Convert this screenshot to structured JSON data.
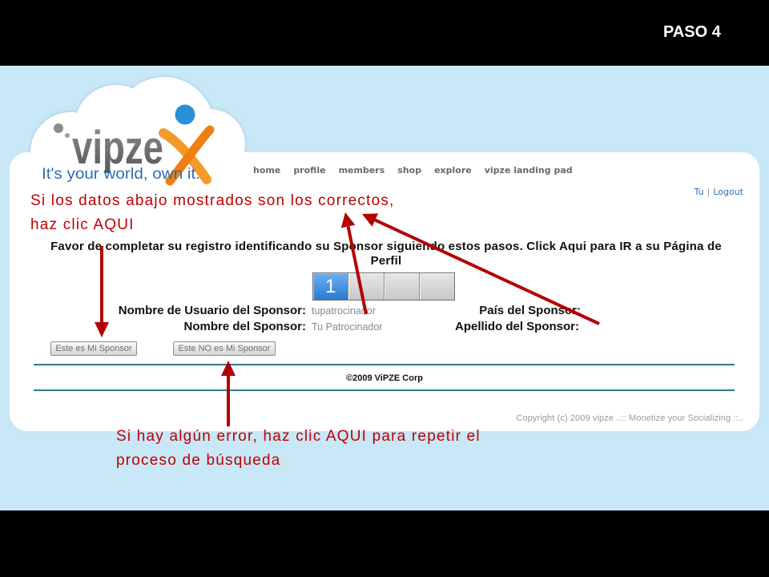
{
  "slide": {
    "step_label": "PASO 4"
  },
  "logo": {
    "wordmark": "vipze",
    "tagline": "It's your world, own it."
  },
  "nav": {
    "items": [
      "home",
      "profile",
      "members",
      "shop",
      "explore",
      "vipze landing pad"
    ]
  },
  "user_links": {
    "user": "Tu",
    "separator": "|",
    "logout": "Logout"
  },
  "callouts": {
    "confirm_hint": [
      "Si los datos abajo mostrados son los correctos,",
      "haz clic AQUI"
    ],
    "error_hint": [
      "Si hay algún error, haz clic AQUI para repetir el",
      "proceso de búsqueda"
    ]
  },
  "intro": [
    "Favor de completar su registro identificando su Sponsor siguiendo estos pasos. Click Aqui para IR a su Página de",
    "Perfil"
  ],
  "steps": {
    "current_label": "1",
    "count": 4
  },
  "sponsor_form": {
    "username_label": "Nombre de Usuario del Sponsor:",
    "username_value": "tupatrocinador",
    "name_label": "Nombre del Sponsor:",
    "name_value": "Tu Patrocinador",
    "country_label": "País del Sponsor:",
    "lastname_label": "Apellido del Sponsor:"
  },
  "buttons": {
    "confirm": "Este es Mi Sponsor",
    "reject": "Este NO es Mi Sponsor"
  },
  "footer": {
    "corp": "©2009 ViPZE Corp",
    "copyright": "Copyright (c) 2009 vipze ..:: Monetize your Socializing ::.."
  },
  "icons": {
    "logo_mark": "person-x-icon",
    "annotation": "arrow-icon"
  },
  "colors": {
    "callout_red": "#c00000",
    "arrow_red": "#b40000",
    "page_sky": "#c8e7f7",
    "link_blue": "#2e6db4",
    "step_active": "#2a7ad0",
    "rule_teal": "#2f7b8c"
  }
}
